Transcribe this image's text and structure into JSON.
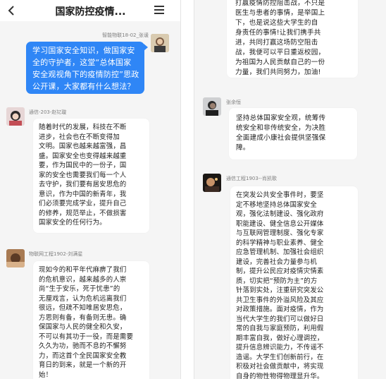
{
  "header": {
    "title": "国家防控疫情..."
  },
  "left": {
    "messages": [
      {
        "sender": "智能物联18-02_张谖",
        "text": "学习国家安全知识，做国家安\n全的守护者，这堂“总体国家\n安全观视角下的疫情防控”思政\n公开课，大家都有什么想法？"
      },
      {
        "sender": "通信-203-赵钇璇",
        "text": "随着时代的发展，科技在不断\n进步，社会也在不断变得加\n文明。国家也越来越富强，昌\n盛。国家安全也变得越来越重\n要，作为国民中的一份子，国\n家的安全也需要我们每一个人\n去守护，我们要有居安思危的\n意识，作为中国的新青年，我\n们必须要完成学业，提升自己\n的修养，规范举止，不做损害\n国家安全的任何行为。"
      },
      {
        "sender": "物联网工程1902-刘满星",
        "text": "现如今的和平年代麻痹了我们\n的危机意识，越来越多的人崇\n尚“生于安乐，死于忧患”的\n无厘戏言，认为危机远离我们\n很远，但疏不知唯居安思危，\n方思则有备，有备则无患。确\n保国家与人民的健全和久安，\n不可以有其功于一役，而是需要\n久久为功，驰而不息的不懈努\n力，而这首个全民国家安全教\n育日的到来，就是一个新的开\n始！"
      }
    ]
  },
  "right": {
    "messages": [
      {
        "sender": "",
        "text": "打赢疫情防控阻击战，不只是\n医生与患者的事情，是举国上\n下，也是说这些大学生的自\n身责任的事情!让我们携手共\n进，共同打赢这场防空阻击\n战，我便可以平日重返校园，\n为祖国为人民贡献自己的一份\n力量，我们共同努力，加油!"
      },
      {
        "sender": "张余恒",
        "text": "坚持总体国家安全观，统筹传\n统安全和非传统安全，为决胜\n全面建成小康社会提供坚强保\n障。"
      },
      {
        "sender": "通信工程1903--肖凯歌",
        "text": "在突发公共安全事件时，要坚\n定不移地坚持总体国家安全\n观，强化法制建设、强化政府\n职能建设、健全信息公开媒体\n与互联网管理制度、强化专家\n的科学精神与职业素养、健全\n应急管理机制、加强社会组织\n建设，完善社会力量参与机\n制，提升公民应对疫情灾情素\n质，切实把“预防为主”的方\n针落到实处，注重研究突发公\n共卫生事件的外溢风险及其应\n对政策措施。面对疫情，作为\n当代大学生的我们可以做好日\n常的自我与家庭预防，利用假\n期丰富自我，做好心理调控，\n提升信息辨识能力，不传谣不\n造谣。大学生们创新前行，在\n积极对社会做贡献中，将实现\n自身的物性物得物理显升华。"
      }
    ]
  },
  "colors": {
    "accent_blue": "#2f86f6",
    "background": "#f5f5f5",
    "bubble": "#ffffff"
  },
  "icons": {
    "back": "chevron-left-icon",
    "menu": "menu-icon"
  }
}
